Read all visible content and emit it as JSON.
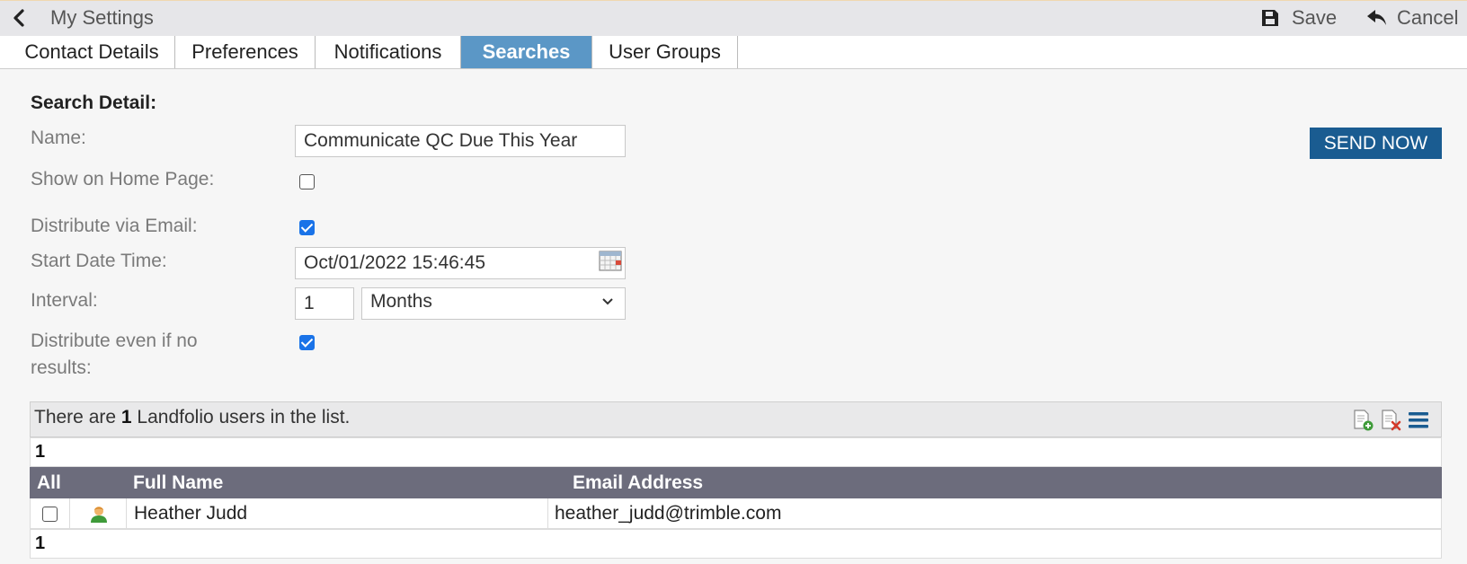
{
  "header": {
    "title": "My Settings",
    "save_label": "Save",
    "cancel_label": "Cancel"
  },
  "tabs": [
    {
      "label": "Contact Details",
      "active": false
    },
    {
      "label": "Preferences",
      "active": false
    },
    {
      "label": "Notifications",
      "active": false
    },
    {
      "label": "Searches",
      "active": true
    },
    {
      "label": "User Groups",
      "active": false
    }
  ],
  "form": {
    "section_title": "Search Detail:",
    "name_label": "Name:",
    "name_value": "Communicate QC Due This Year",
    "send_now_label": "SEND NOW",
    "show_home_label": "Show on Home Page:",
    "show_home_checked": false,
    "distribute_email_label": "Distribute via Email:",
    "distribute_email_checked": true,
    "start_date_label": "Start Date Time:",
    "start_date_value": "Oct/01/2022 15:46:45",
    "interval_label": "Interval:",
    "interval_value": "1",
    "interval_unit": "Months",
    "distribute_no_results_label_1": "Distribute even if no",
    "distribute_no_results_label_2": "results:",
    "distribute_no_results_checked": true
  },
  "list": {
    "count_prefix": "There are",
    "count": "1",
    "count_suffix": "Landfolio users in the list.",
    "page_top": "1",
    "page_bottom": "1",
    "columns": {
      "all": "All",
      "full_name": "Full Name",
      "email": "Email Address"
    },
    "rows": [
      {
        "full_name": "Heather Judd",
        "email": "heather_judd@trimble.com",
        "checked": false
      }
    ]
  },
  "colors": {
    "active_tab": "#5b97c6",
    "send_button": "#1a5c91",
    "grid_header": "#6c6c7c",
    "checkbox_checked": "#1a73e8"
  },
  "icons": {
    "back": "chevron-left-icon",
    "save": "floppy-disk-icon",
    "cancel": "undo-arrow-icon",
    "calendar": "calendar-icon",
    "add": "add-document-icon",
    "remove": "remove-document-icon",
    "menu": "hamburger-menu-icon",
    "user": "user-icon"
  }
}
